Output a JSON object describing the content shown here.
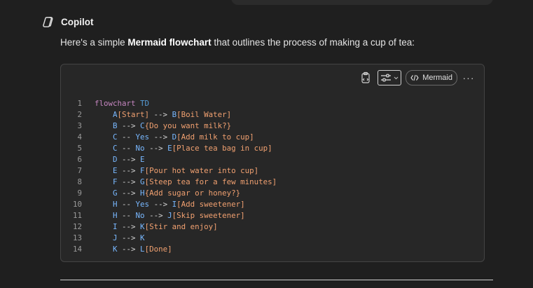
{
  "assistant": {
    "name": "Copilot"
  },
  "intro": {
    "before": "Here's a simple ",
    "bold": "Mermaid flowchart",
    "after": " that outlines the process of making a cup of tea:"
  },
  "code_toolbar": {
    "language": "Mermaid",
    "more": "···"
  },
  "code_lines": [
    {
      "n": "1",
      "tokens": [
        [
          "kw",
          "flowchart"
        ],
        [
          "tx",
          " "
        ],
        [
          "kw2",
          "TD"
        ]
      ]
    },
    {
      "n": "2",
      "tokens": [
        [
          "tx",
          "    "
        ],
        [
          "id",
          "A"
        ],
        [
          "str",
          "[Start]"
        ],
        [
          "op",
          " --> "
        ],
        [
          "id",
          "B"
        ],
        [
          "str",
          "[Boil Water]"
        ]
      ]
    },
    {
      "n": "3",
      "tokens": [
        [
          "tx",
          "    "
        ],
        [
          "id",
          "B"
        ],
        [
          "op",
          " --> "
        ],
        [
          "id",
          "C"
        ],
        [
          "str",
          "{Do you want milk?}"
        ]
      ]
    },
    {
      "n": "4",
      "tokens": [
        [
          "tx",
          "    "
        ],
        [
          "id",
          "C"
        ],
        [
          "op",
          " -- "
        ],
        [
          "id",
          "Yes"
        ],
        [
          "op",
          " --> "
        ],
        [
          "id",
          "D"
        ],
        [
          "str",
          "[Add milk to cup]"
        ]
      ]
    },
    {
      "n": "5",
      "tokens": [
        [
          "tx",
          "    "
        ],
        [
          "id",
          "C"
        ],
        [
          "op",
          " -- "
        ],
        [
          "id",
          "No"
        ],
        [
          "op",
          " --> "
        ],
        [
          "id",
          "E"
        ],
        [
          "str",
          "[Place tea bag in cup]"
        ]
      ]
    },
    {
      "n": "6",
      "tokens": [
        [
          "tx",
          "    "
        ],
        [
          "id",
          "D"
        ],
        [
          "op",
          " --> "
        ],
        [
          "id",
          "E"
        ]
      ]
    },
    {
      "n": "7",
      "tokens": [
        [
          "tx",
          "    "
        ],
        [
          "id",
          "E"
        ],
        [
          "op",
          " --> "
        ],
        [
          "id",
          "F"
        ],
        [
          "str",
          "[Pour hot water into cup]"
        ]
      ]
    },
    {
      "n": "8",
      "tokens": [
        [
          "tx",
          "    "
        ],
        [
          "id",
          "F"
        ],
        [
          "op",
          " --> "
        ],
        [
          "id",
          "G"
        ],
        [
          "str",
          "[Steep tea for a few minutes]"
        ]
      ]
    },
    {
      "n": "9",
      "tokens": [
        [
          "tx",
          "    "
        ],
        [
          "id",
          "G"
        ],
        [
          "op",
          " --> "
        ],
        [
          "id",
          "H"
        ],
        [
          "str",
          "{Add sugar or honey?}"
        ]
      ]
    },
    {
      "n": "10",
      "tokens": [
        [
          "tx",
          "    "
        ],
        [
          "id",
          "H"
        ],
        [
          "op",
          " -- "
        ],
        [
          "id",
          "Yes"
        ],
        [
          "op",
          " --> "
        ],
        [
          "id",
          "I"
        ],
        [
          "str",
          "[Add sweetener]"
        ]
      ]
    },
    {
      "n": "11",
      "tokens": [
        [
          "tx",
          "    "
        ],
        [
          "id",
          "H"
        ],
        [
          "op",
          " -- "
        ],
        [
          "id",
          "No"
        ],
        [
          "op",
          " --> "
        ],
        [
          "id",
          "J"
        ],
        [
          "str",
          "[Skip sweetener]"
        ]
      ]
    },
    {
      "n": "12",
      "tokens": [
        [
          "tx",
          "    "
        ],
        [
          "id",
          "I"
        ],
        [
          "op",
          " --> "
        ],
        [
          "id",
          "K"
        ],
        [
          "str",
          "[Stir and enjoy]"
        ]
      ]
    },
    {
      "n": "13",
      "tokens": [
        [
          "tx",
          "    "
        ],
        [
          "id",
          "J"
        ],
        [
          "op",
          " --> "
        ],
        [
          "id",
          "K"
        ]
      ]
    },
    {
      "n": "14",
      "tokens": [
        [
          "tx",
          "    "
        ],
        [
          "id",
          "K"
        ],
        [
          "op",
          " --> "
        ],
        [
          "id",
          "L"
        ],
        [
          "str",
          "[Done]"
        ]
      ]
    }
  ]
}
